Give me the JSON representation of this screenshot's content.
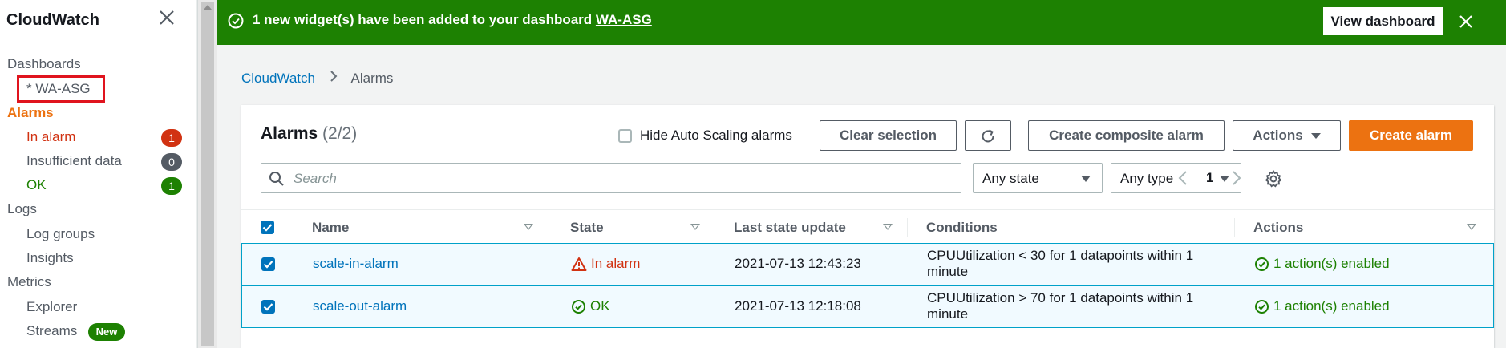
{
  "sidebar": {
    "title": "CloudWatch",
    "dashboards_label": "Dashboards",
    "dashboard_item": "* WA-ASG",
    "alarms_label": "Alarms",
    "alarms_items": [
      {
        "label": "In alarm",
        "count": "1"
      },
      {
        "label": "Insufficient data",
        "count": "0"
      },
      {
        "label": "OK",
        "count": "1"
      }
    ],
    "logs_label": "Logs",
    "logs_items": [
      "Log groups",
      "Insights"
    ],
    "metrics_label": "Metrics",
    "metrics_items": [
      "Explorer",
      "Streams"
    ],
    "new_badge": "New"
  },
  "flash": {
    "message": "1 new widget(s) have been added to your dashboard ",
    "link": "WA-ASG",
    "button": "View dashboard"
  },
  "breadcrumb": {
    "root": "CloudWatch",
    "current": "Alarms"
  },
  "panel": {
    "title": "Alarms",
    "count": "(2/2)",
    "hide_asg_label": "Hide Auto Scaling alarms",
    "clear_selection": "Clear selection",
    "create_composite": "Create composite alarm",
    "actions": "Actions",
    "create_alarm": "Create alarm",
    "search_placeholder": "Search",
    "state_filter": "Any state",
    "type_filter": "Any type",
    "page": "1"
  },
  "table": {
    "headers": {
      "name": "Name",
      "state": "State",
      "last_update": "Last state update",
      "conditions": "Conditions",
      "actions": "Actions"
    },
    "rows": [
      {
        "name": "scale-in-alarm",
        "state": "In alarm",
        "last_update": "2021-07-13 12:43:23",
        "conditions": "CPUUtilization < 30 for 1 datapoints within 1 minute",
        "actions": "1 action(s) enabled"
      },
      {
        "name": "scale-out-alarm",
        "state": "OK",
        "last_update": "2021-07-13 12:18:08",
        "conditions": "CPUUtilization > 70 for 1 datapoints within 1 minute",
        "actions": "1 action(s) enabled"
      }
    ]
  },
  "colors": {
    "flash_green": "#1d8102",
    "primary_orange": "#ec7211",
    "link_blue": "#0073bb",
    "alarm_red": "#d13212"
  }
}
